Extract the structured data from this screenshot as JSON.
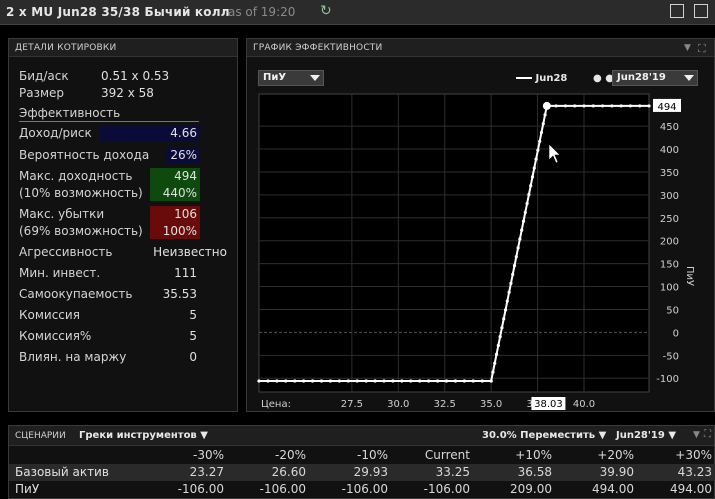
{
  "window": {
    "title": "2 x MU Jun28 35/38 Бычий колл",
    "as_of": "as of 19:20"
  },
  "quote": {
    "header": "ДЕТАЛИ КОТИРОВКИ",
    "bid_ask_label": "Бид/аск",
    "bid_ask_value": "0.51 x 0.53",
    "size_label": "Размер",
    "size_value": "392 x 58",
    "section_title": "Эффективность",
    "profit_risk_label": "Доход/риск",
    "profit_risk_value": "4.66",
    "profit_prob_label": "Вероятность дохода",
    "profit_prob_value": "26%",
    "max_return_label": "Макс. доходность",
    "max_return_value": "494",
    "max_return_sub_label": "(10% возможность)",
    "max_return_sub_value": "440%",
    "max_loss_label": "Макс. убытки",
    "max_loss_value": "106",
    "max_loss_sub_label": "(69% возможность)",
    "max_loss_sub_value": "100%",
    "aggressiveness_label": "Агрессивность",
    "aggressiveness_value": "Неизвестно",
    "min_invest_label": "Мин. инвест.",
    "min_invest_value": "111",
    "breakeven_label": "Самоокупаемость",
    "breakeven_value": "35.53",
    "commission_label": "Комиссия",
    "commission_value": "5",
    "commission_pct_label": "Комиссия%",
    "commission_pct_value": "5",
    "margin_impact_label": "Влиян. на маржу",
    "margin_impact_value": "0",
    "colors": {
      "profit_risk_bg": "#0b0b3a",
      "prob_bg": "#0b0b3a",
      "max_return_bg": "#0e4a0e",
      "max_loss_bg": "#6a0b0b"
    }
  },
  "perf": {
    "header": "ГРАФИК ЭФФЕКТИВНОСТИ",
    "metric_dropdown": "ПиУ",
    "legend_series": "Jun28",
    "date_dropdown": "Jun28'19",
    "price_label": "Цена:",
    "marker_value": "494",
    "cursor_price": "38.03"
  },
  "chart_data": {
    "type": "line",
    "ylabel": "ПиУ",
    "xlabel": "Цена:",
    "xlim": [
      22.5,
      43.5
    ],
    "ylim": [
      -130,
      520
    ],
    "x_ticks": [
      "27.5",
      "30.0",
      "32.5",
      "35.0",
      "37.5",
      "40.0"
    ],
    "x_tick_values": [
      27.5,
      30.0,
      32.5,
      35.0,
      37.5,
      40.0
    ],
    "y_ticks": [
      "-100",
      "-50",
      "0",
      "50",
      "100",
      "150",
      "200",
      "250",
      "300",
      "350",
      "400",
      "450"
    ],
    "y_tick_values": [
      -100,
      -50,
      0,
      50,
      100,
      150,
      200,
      250,
      300,
      350,
      400,
      450
    ],
    "grid": true,
    "series": [
      {
        "name": "Jun28",
        "x": [
          22.5,
          35.0,
          38.0,
          43.5
        ],
        "y": [
          -106,
          -106,
          494,
          494
        ]
      }
    ]
  },
  "scenarios": {
    "header": "СЦЕНАРИИ",
    "greeks_dropdown": "Греки инструментов",
    "shift_dropdown": "30.0% Переместить",
    "date_dropdown": "Jun28'19",
    "columns": [
      "-30%",
      "-20%",
      "-10%",
      "Current",
      "+10%",
      "+20%",
      "+30%"
    ],
    "rows": [
      {
        "label": "Базовый актив",
        "values": [
          "23.27",
          "26.60",
          "29.93",
          "33.25",
          "36.58",
          "39.90",
          "43.23"
        ]
      },
      {
        "label": "ПиУ",
        "values": [
          "-106.00",
          "-106.00",
          "-106.00",
          "-106.00",
          "209.00",
          "494.00",
          "494.00"
        ]
      }
    ]
  }
}
